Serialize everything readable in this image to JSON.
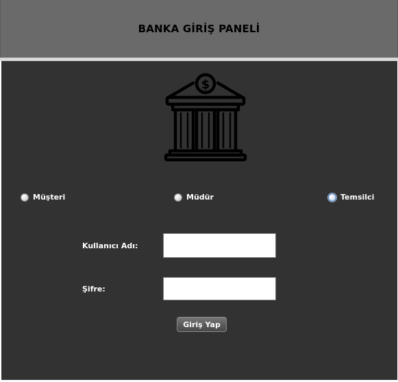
{
  "header": {
    "title": "BANKA GİRİŞ PANELİ"
  },
  "icon": {
    "name": "bank-icon",
    "symbol": "$"
  },
  "roles": {
    "selected": "Temsilci",
    "options": [
      {
        "label": "Müşteri",
        "selected": false
      },
      {
        "label": "Müdür",
        "selected": false
      },
      {
        "label": "Temsilci",
        "selected": true
      }
    ]
  },
  "form": {
    "username_label": "Kullanıcı Adı:",
    "username_value": "",
    "password_label": "Şifre:",
    "password_value": "",
    "submit_label": "Giriş Yap"
  },
  "colors": {
    "header_bg": "#6a6a6a",
    "panel_bg": "#323232",
    "divider": "#d8d8d8",
    "text_light": "#ffffff"
  }
}
